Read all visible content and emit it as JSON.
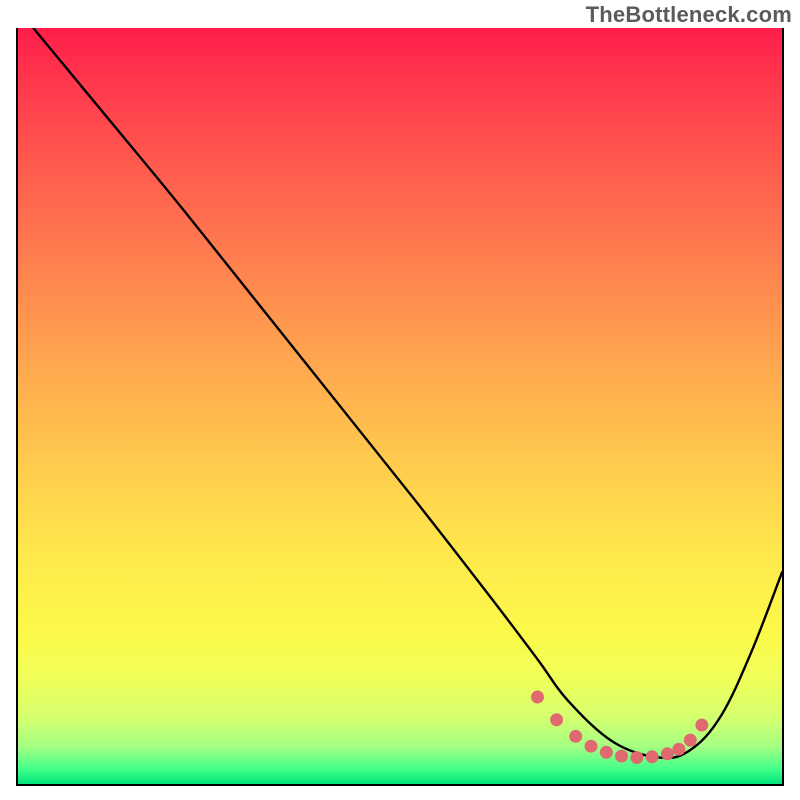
{
  "watermark": "TheBottleneck.com",
  "chart_data": {
    "type": "line",
    "title": "",
    "xlabel": "",
    "ylabel": "",
    "xlim": [
      0,
      100
    ],
    "ylim": [
      0,
      100
    ],
    "series": [
      {
        "name": "curve",
        "x_pct": [
          2.0,
          11.0,
          22.0,
          37.0,
          52.0,
          62.0,
          68.0,
          72.0,
          78.0,
          84.0,
          88.0,
          92.0,
          96.0,
          100.0
        ],
        "y_pct": [
          100.0,
          89.0,
          75.5,
          56.5,
          37.5,
          24.5,
          16.5,
          11.0,
          5.5,
          3.5,
          4.5,
          9.0,
          17.5,
          28.0
        ]
      }
    ],
    "highlight_region": {
      "name": "valley-dots",
      "x_pct": [
        68.0,
        70.5,
        73.0,
        75.0,
        77.0,
        79.0,
        81.0,
        83.0,
        85.0,
        86.5,
        88.0,
        89.5
      ],
      "y_pct": [
        11.5,
        8.5,
        6.3,
        5.0,
        4.2,
        3.7,
        3.5,
        3.6,
        4.0,
        4.6,
        5.8,
        7.8
      ]
    },
    "colors": {
      "curve": "#000000",
      "dots": "#e0686f"
    }
  }
}
